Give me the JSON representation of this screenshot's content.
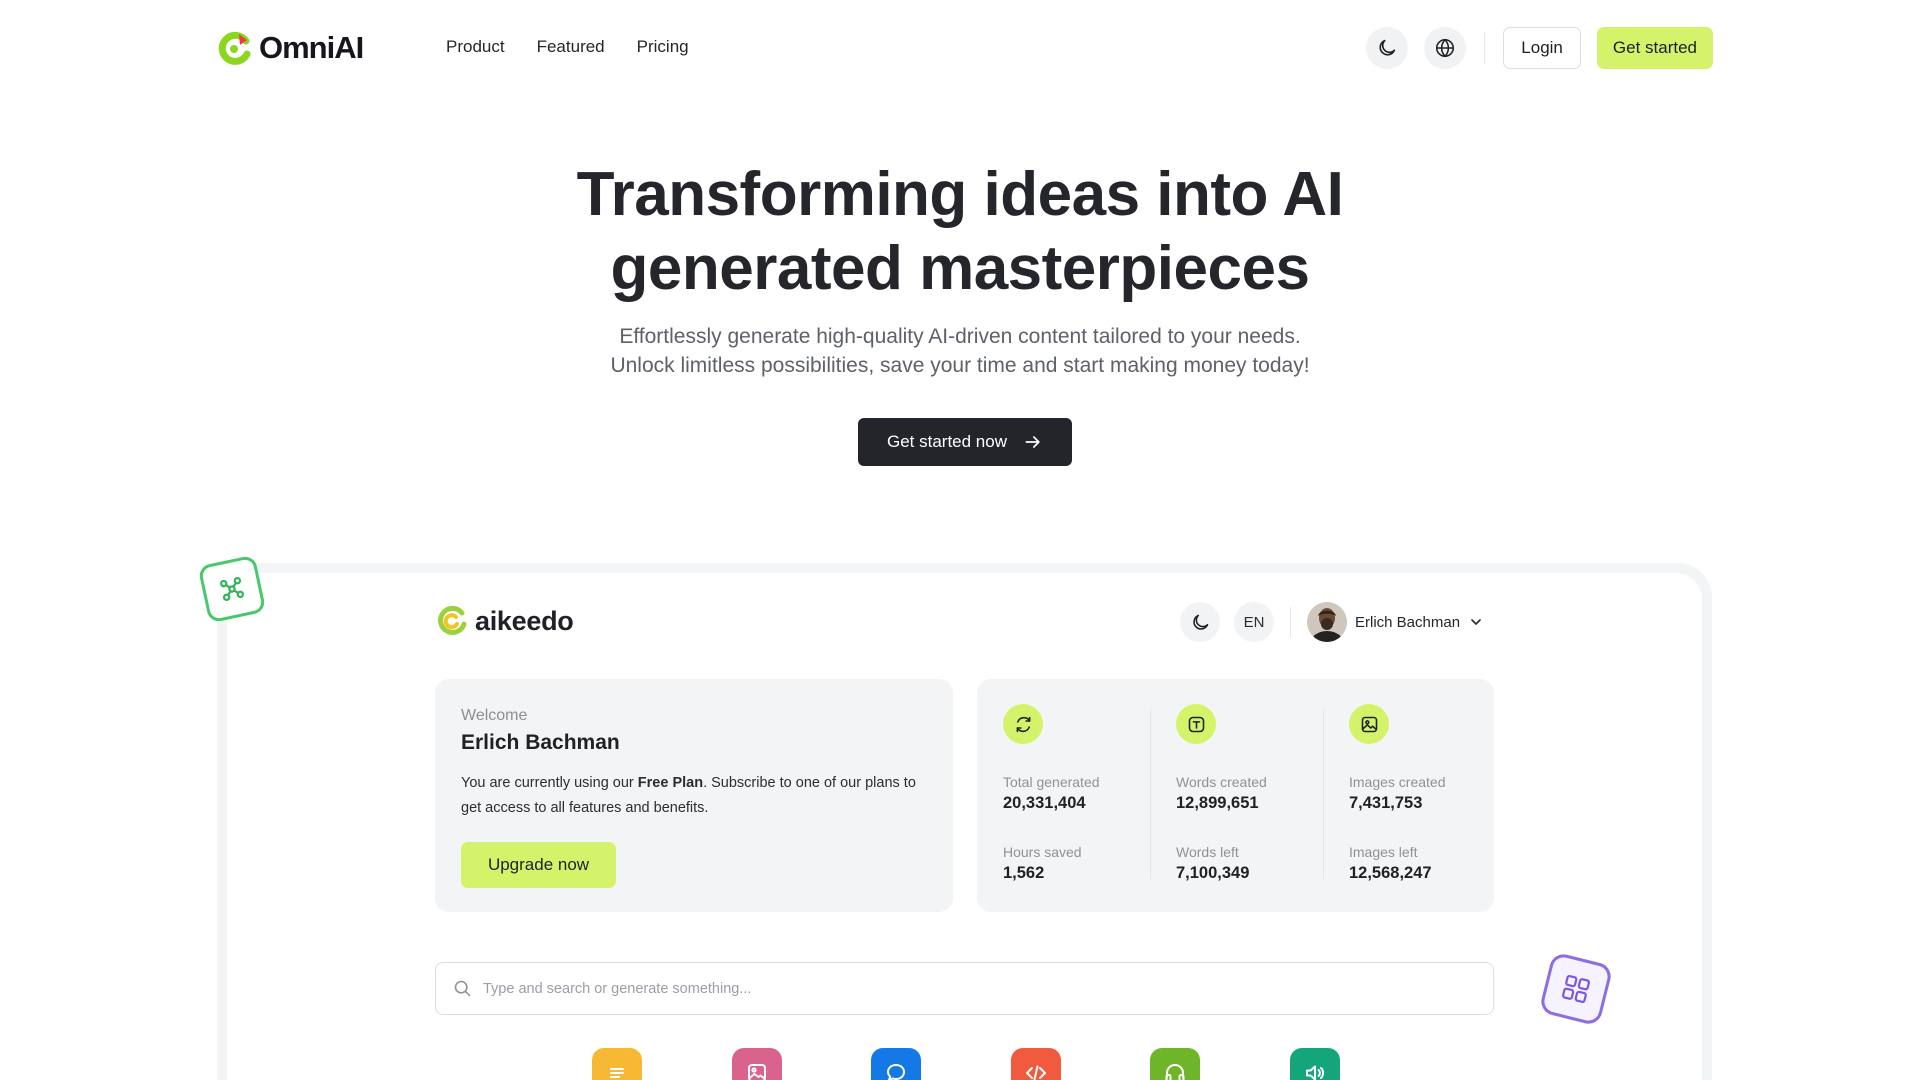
{
  "brand": {
    "name": "OmniAI",
    "mark": "omniai-logo-icon"
  },
  "nav": {
    "links": [
      "Product",
      "Featured",
      "Pricing"
    ],
    "theme_icon": "moon-icon",
    "language_icon": "globe-icon",
    "login_label": "Login",
    "get_started_label": "Get started"
  },
  "hero": {
    "title_line1": "Transforming ideas into AI",
    "title_line2": "generated masterpieces",
    "subtitle_line1": "Effortlessly generate high-quality AI-driven content tailored to your needs.",
    "subtitle_line2": "Unlock limitless possibilities, save your time and start making money today!",
    "cta_label": "Get started now",
    "cta_icon": "arrow-right-icon"
  },
  "dashboard": {
    "logo_name": "aikeedo",
    "language": "EN",
    "user_name": "Erlich Bachman",
    "welcome": {
      "label": "Welcome",
      "name": "Erlich Bachman",
      "text_prefix": "You are currently using our ",
      "plan": "Free Plan",
      "text_suffix": ". Subscribe to one of our plans to get access to all features and benefits.",
      "upgrade_label": "Upgrade now"
    },
    "stats": [
      {
        "icon": "refresh-icon",
        "top_label": "Total generated",
        "top_value": "20,331,404",
        "bottom_label": "Hours saved",
        "bottom_value": "1,562"
      },
      {
        "icon": "text-icon",
        "top_label": "Words created",
        "top_value": "12,899,651",
        "bottom_label": "Words left",
        "bottom_value": "7,100,349"
      },
      {
        "icon": "image-icon",
        "top_label": "Images created",
        "top_value": "7,431,753",
        "bottom_label": "Images left",
        "bottom_value": "12,568,247"
      }
    ],
    "search_placeholder": "Type and search or generate something...",
    "tools": [
      {
        "icon": "text-lines-icon",
        "color": "#f7b934"
      },
      {
        "icon": "image-icon",
        "color": "#d9638d"
      },
      {
        "icon": "chat-icon",
        "color": "#1478e6"
      },
      {
        "icon": "code-icon",
        "color": "#f05a3f"
      },
      {
        "icon": "headphones-icon",
        "color": "#6fb52a"
      },
      {
        "icon": "speaker-icon",
        "color": "#14a57b"
      }
    ]
  },
  "colors": {
    "accent": "#d5f36a",
    "dark": "#23252b",
    "green_badge": "#46c86b",
    "purple_badge": "#8c6de3"
  }
}
